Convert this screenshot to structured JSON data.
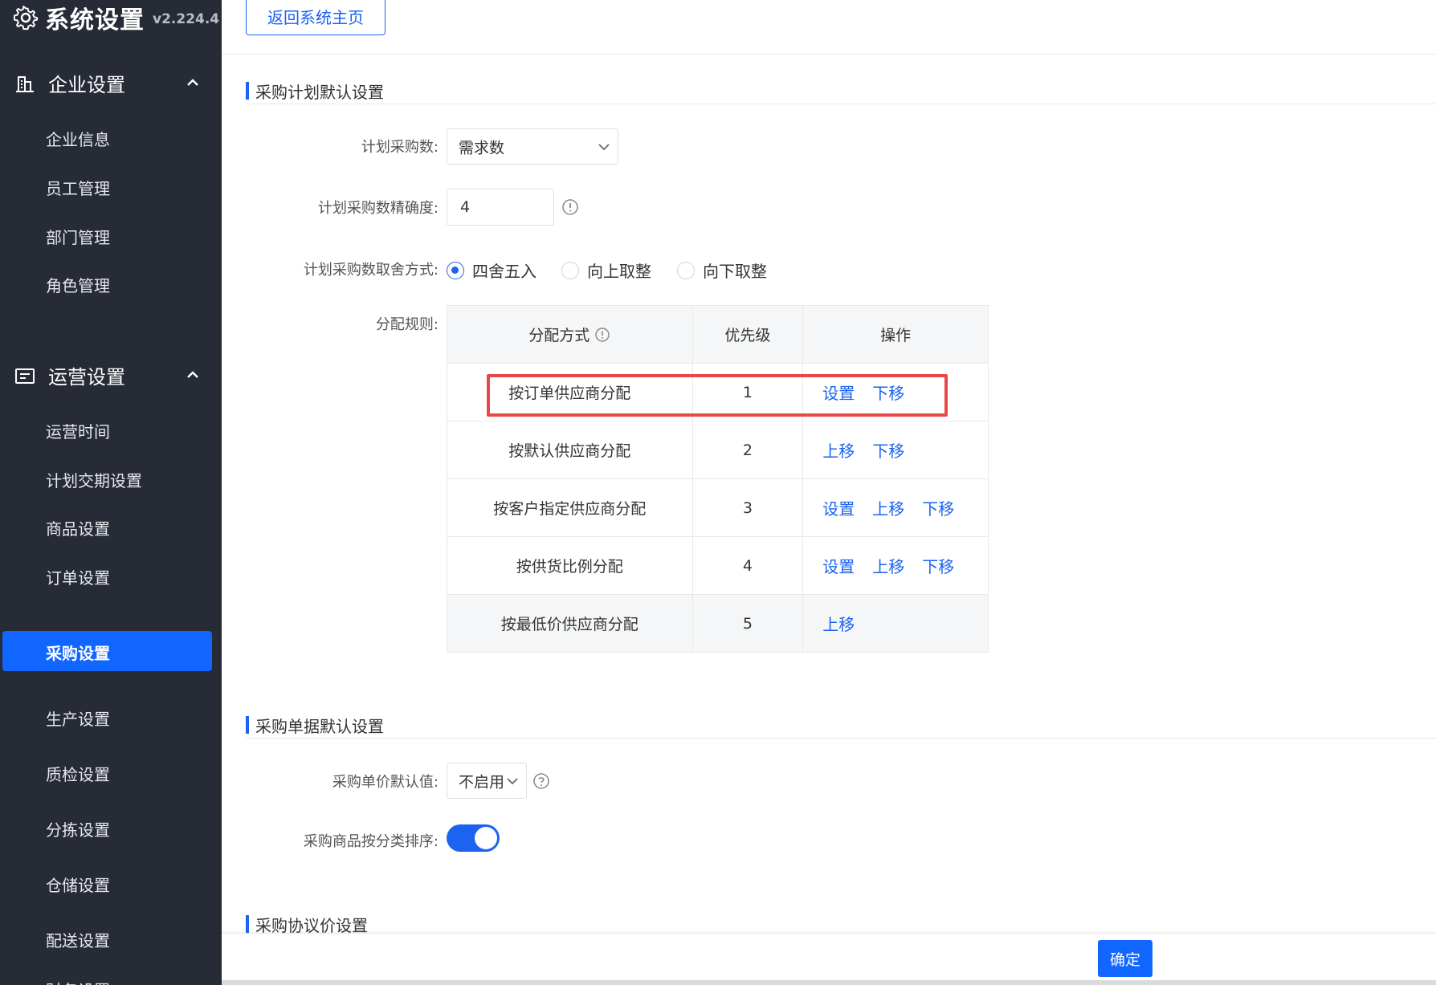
{
  "brand": {
    "title": "系统设置",
    "version": "v2.224.4"
  },
  "sidebar": {
    "groups": [
      {
        "label": "企业设置",
        "items": [
          "企业信息",
          "员工管理",
          "部门管理",
          "角色管理"
        ]
      },
      {
        "label": "运营设置",
        "items": [
          "运营时间",
          "计划交期设置",
          "商品设置",
          "订单设置",
          "采购设置",
          "生产设置",
          "质检设置",
          "分拣设置",
          "仓储设置",
          "配送设置",
          "财务设置"
        ]
      }
    ],
    "active_item": "采购设置"
  },
  "topbar": {
    "back_label": "返回系统主页"
  },
  "section1": {
    "title": "采购计划默认设置",
    "plan_qty_label": "计划采购数:",
    "plan_qty_value": "需求数",
    "precision_label": "计划采购数精确度:",
    "precision_value": "4",
    "rounding_label": "计划采购数取舍方式:",
    "rounding_options": [
      "四舍五入",
      "向上取整",
      "向下取整"
    ],
    "rounding_selected": "四舍五入",
    "rules_label": "分配规则:",
    "table": {
      "headers": [
        "分配方式",
        "优先级",
        "操作"
      ],
      "rows": [
        {
          "method": "按订单供应商分配",
          "priority": "1",
          "ops": [
            "设置",
            "下移"
          ]
        },
        {
          "method": "按默认供应商分配",
          "priority": "2",
          "ops": [
            "上移",
            "下移"
          ]
        },
        {
          "method": "按客户指定供应商分配",
          "priority": "3",
          "ops": [
            "设置",
            "上移",
            "下移"
          ]
        },
        {
          "method": "按供货比例分配",
          "priority": "4",
          "ops": [
            "设置",
            "上移",
            "下移"
          ]
        },
        {
          "method": "按最低价供应商分配",
          "priority": "5",
          "ops": [
            "上移"
          ]
        }
      ]
    }
  },
  "section2": {
    "title": "采购单据默认设置",
    "unit_price_label": "采购单价默认值:",
    "unit_price_value": "不启用",
    "sort_label": "采购商品按分类排序:",
    "sort_enabled": true
  },
  "section3": {
    "title": "采购协议价设置"
  },
  "footer": {
    "ok_label": "确定"
  },
  "colors": {
    "accent": "#1b63f0",
    "sidebar_bg": "#262b36",
    "highlight": "#e84848"
  }
}
